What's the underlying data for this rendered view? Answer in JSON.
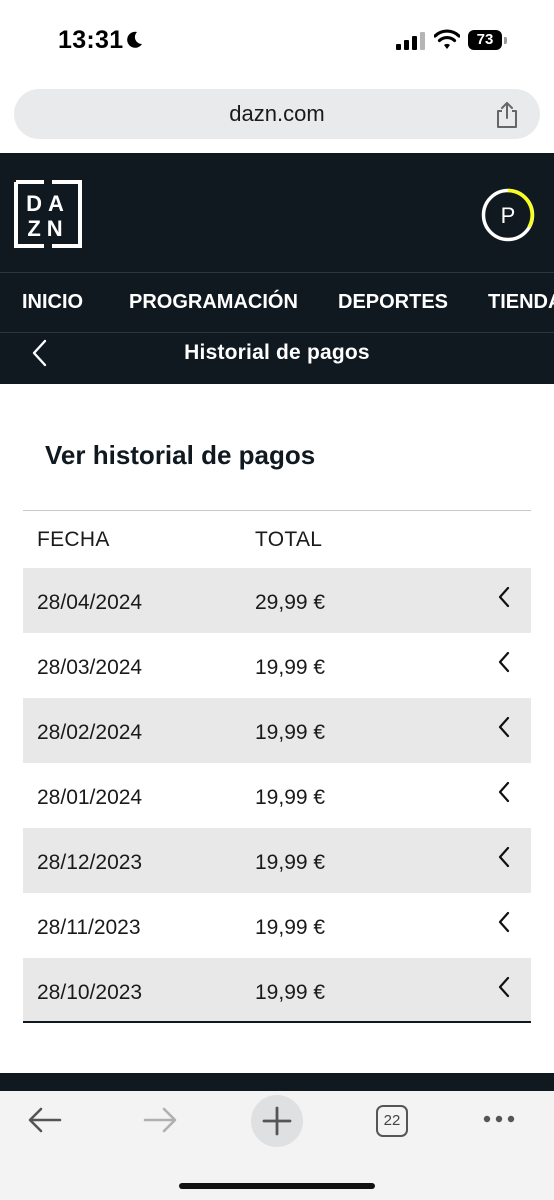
{
  "status_bar": {
    "time": "13:31",
    "battery": "73"
  },
  "browser": {
    "url": "dazn.com",
    "tab_count": "22"
  },
  "header": {
    "logo_line1": "DA",
    "logo_line2": "ZN",
    "avatar_initial": "P",
    "nav_items": [
      {
        "label": "INICIO"
      },
      {
        "label": "PROGRAMACIÓN"
      },
      {
        "label": "DEPORTES"
      },
      {
        "label": "TIENDA"
      }
    ],
    "page_subtitle": "Historial de pagos"
  },
  "content": {
    "heading": "Ver historial de pagos",
    "columns": {
      "date": "FECHA",
      "total": "TOTAL"
    },
    "rows": [
      {
        "date": "28/04/2024",
        "total": "29,99 €"
      },
      {
        "date": "28/03/2024",
        "total": "19,99 €"
      },
      {
        "date": "28/02/2024",
        "total": "19,99 €"
      },
      {
        "date": "28/01/2024",
        "total": "19,99 €"
      },
      {
        "date": "28/12/2023",
        "total": "19,99 €"
      },
      {
        "date": "28/11/2023",
        "total": "19,99 €"
      },
      {
        "date": "28/10/2023",
        "total": "19,99 €"
      }
    ]
  },
  "colors": {
    "dazn_dark": "#101820",
    "dazn_accent": "#f7ff1a",
    "row_shade": "#e8e8e8"
  }
}
